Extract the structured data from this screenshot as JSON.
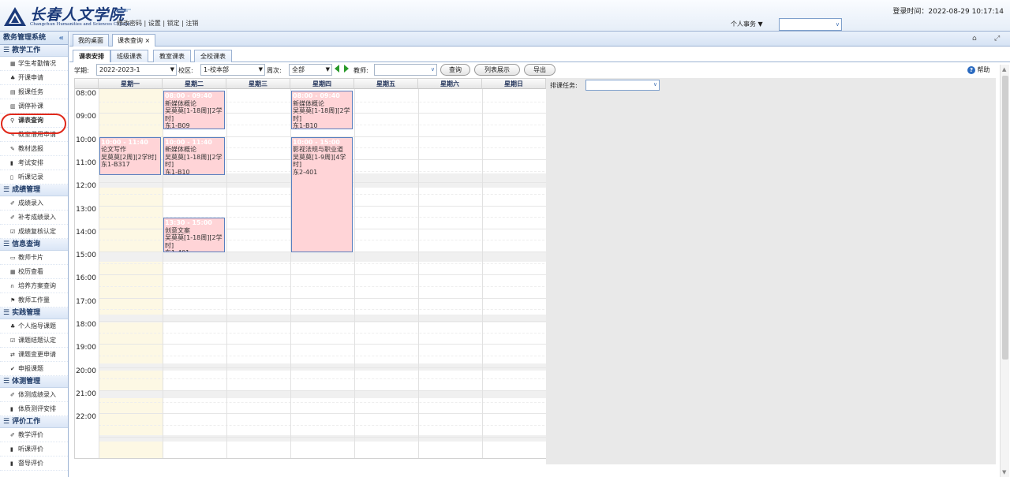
{
  "header": {
    "logo_cn": "长春人文学院",
    "logo_en": "Changchun Humanities and Sciences College",
    "links": [
      "修改密码",
      "设置",
      "锁定",
      "注销"
    ],
    "login_time": "登录时间：2022-08-29 10:17:14",
    "personal_menu": "个人事务 ▼"
  },
  "sidebar": {
    "title": "教务管理系统",
    "collapse_glyph": "«",
    "sections": [
      {
        "title": "教学工作",
        "items": [
          {
            "label": "学生考勤情况",
            "icon": "calendar-icon"
          },
          {
            "label": "开课申请",
            "icon": "users-icon"
          },
          {
            "label": "报课任务",
            "icon": "form-icon"
          },
          {
            "label": "调停补课",
            "icon": "grid-icon"
          },
          {
            "label": "课表查询",
            "icon": "search-icon",
            "active": true
          },
          {
            "label": "教室借用申请",
            "icon": "edit-icon"
          },
          {
            "label": "教材选报",
            "icon": "edit-icon"
          },
          {
            "label": "考试安排",
            "icon": "doc-icon"
          },
          {
            "label": "听课记录",
            "icon": "file-icon"
          }
        ]
      },
      {
        "title": "成绩管理",
        "items": [
          {
            "label": "成绩录入",
            "icon": "pencil-icon"
          },
          {
            "label": "补考成绩录入",
            "icon": "pencil-icon"
          },
          {
            "label": "成绩复核认定",
            "icon": "check-icon"
          }
        ]
      },
      {
        "title": "信息查询",
        "items": [
          {
            "label": "教师卡片",
            "icon": "card-icon"
          },
          {
            "label": "校历查看",
            "icon": "calendar-icon"
          },
          {
            "label": "培养方案查询",
            "icon": "binoculars-icon"
          },
          {
            "label": "教师工作量",
            "icon": "flag-icon"
          }
        ]
      },
      {
        "title": "实践管理",
        "items": [
          {
            "label": "个人指导课题",
            "icon": "users-icon"
          },
          {
            "label": "课题结题认定",
            "icon": "check-icon"
          },
          {
            "label": "课题变更申请",
            "icon": "swap-icon"
          },
          {
            "label": "申报课题",
            "icon": "tick-icon"
          }
        ]
      },
      {
        "title": "体测管理",
        "items": [
          {
            "label": "体测成绩录入",
            "icon": "pencil-icon"
          },
          {
            "label": "体质测评安排",
            "icon": "doc-icon"
          }
        ]
      },
      {
        "title": "评价工作",
        "items": [
          {
            "label": "教学评价",
            "icon": "pencil-icon"
          },
          {
            "label": "听课评价",
            "icon": "doc-icon"
          },
          {
            "label": "督导评价",
            "icon": "doc-icon"
          }
        ]
      }
    ]
  },
  "tabs": [
    {
      "label": "我的桌面"
    },
    {
      "label": "课表查询 ×"
    }
  ],
  "subtabs": [
    "课表安排",
    "班级课表",
    "教室课表",
    "全校课表"
  ],
  "filters": {
    "term_label": "学期:",
    "term_value": "2022-2023-1",
    "campus_label": "校区:",
    "campus_value": "1-校本部",
    "week_label": "周次:",
    "week_value": "全部",
    "teacher_label": "教师:",
    "teacher_value": "",
    "query_btn": "查询",
    "list_btn": "列表展示",
    "export_btn": "导出",
    "help": "帮助"
  },
  "calendar": {
    "days": [
      "星期一",
      "星期二",
      "星期三",
      "星期四",
      "星期五",
      "星期六",
      "星期日"
    ],
    "hours": [
      "08:00",
      "09:00",
      "10:00",
      "11:00",
      "12:00",
      "13:00",
      "14:00",
      "15:00",
      "16:00",
      "17:00",
      "18:00",
      "19:00",
      "20:00",
      "21:00",
      "22:00"
    ],
    "events": [
      {
        "day": 1,
        "start": "08:00",
        "end": "09:40",
        "time": "08:00 - 09:40",
        "lines": [
          "新媒体概论",
          "吴莫莫[1-18周][2学时]",
          "东1-B09"
        ]
      },
      {
        "day": 3,
        "start": "08:00",
        "end": "09:40",
        "time": "08:00 - 09:40",
        "lines": [
          "新媒体概论",
          "吴莫莫[1-18周][2学时]",
          "东1-B10"
        ]
      },
      {
        "day": 0,
        "start": "10:00",
        "end": "11:40",
        "time": "10:00 - 11:40",
        "lines": [
          "论文写作",
          "吴莫莫[2周][2学时]",
          "东1-B317"
        ]
      },
      {
        "day": 1,
        "start": "10:00",
        "end": "11:40",
        "time": "10:00 - 11:40",
        "lines": [
          "新媒体概论",
          "吴莫莫[1-18周][2学时]",
          "东1-B10"
        ]
      },
      {
        "day": 3,
        "start": "10:00",
        "end": "15:00",
        "time": "10:00 - 15:00",
        "lines": [
          "影视法规与职业道",
          "吴莫莫[1-9周][4学时]",
          "东2-401"
        ]
      },
      {
        "day": 1,
        "start": "13:30",
        "end": "15:00",
        "time": "13:30 - 15:00",
        "lines": [
          "创意文案",
          "吴莫莫[1-18周][2学时]",
          "东1-401"
        ]
      }
    ]
  },
  "right_panel": {
    "arrange_label": "排课任务:",
    "arrange_value": ""
  }
}
